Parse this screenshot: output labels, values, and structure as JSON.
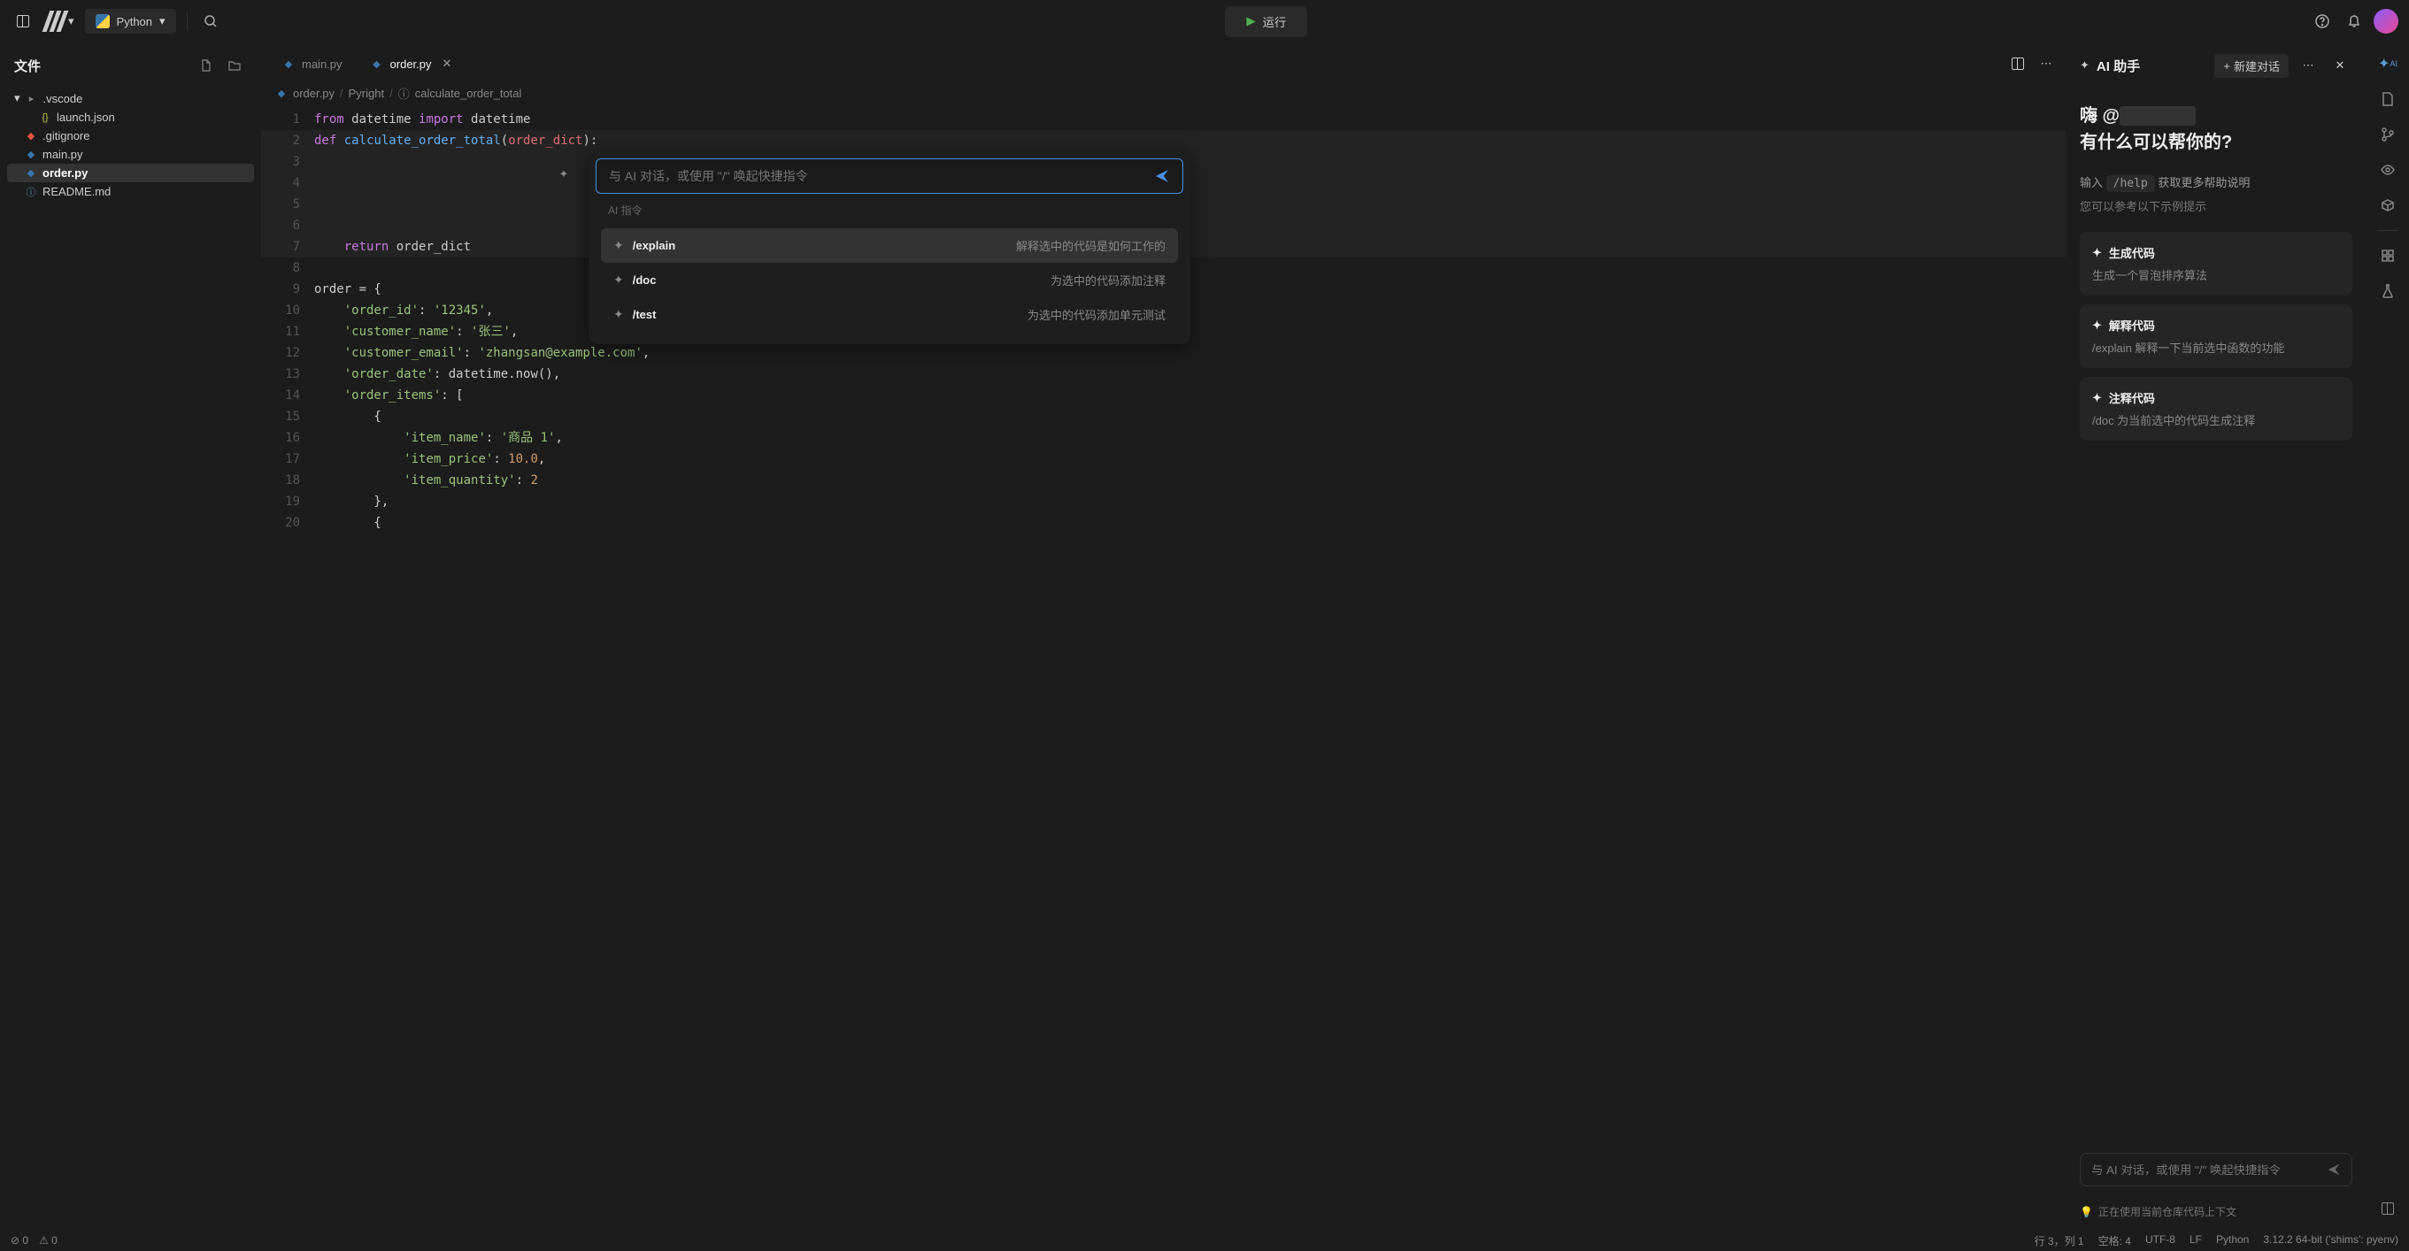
{
  "topbar": {
    "language": "Python",
    "run": "运行"
  },
  "files": {
    "title": "文件",
    "tree": [
      {
        "name": ".vscode",
        "type": "folder",
        "open": true,
        "indent": 0
      },
      {
        "name": "launch.json",
        "type": "json",
        "indent": 2
      },
      {
        "name": ".gitignore",
        "type": "git",
        "indent": 1
      },
      {
        "name": "main.py",
        "type": "py",
        "indent": 1
      },
      {
        "name": "order.py",
        "type": "py",
        "indent": 1,
        "active": true
      },
      {
        "name": "README.md",
        "type": "md",
        "indent": 1
      }
    ]
  },
  "tabs": [
    {
      "name": "main.py",
      "active": false
    },
    {
      "name": "order.py",
      "active": true
    }
  ],
  "breadcrumb": {
    "file": "order.py",
    "module": "Pyright",
    "symbol": "calculate_order_total"
  },
  "code": {
    "lines": [
      {
        "n": 1,
        "html": "<span class='kw'>from</span> datetime <span class='kw'>import</span> datetime"
      },
      {
        "n": 2,
        "html": "<span class='kw'>def</span> <span class='fn'>calculate_order_total</span>(<span class='var'>order_dict</span>):",
        "hl": true
      },
      {
        "n": 3,
        "html": "",
        "hl": true
      },
      {
        "n": 4,
        "html": "",
        "hl": true
      },
      {
        "n": 5,
        "html": "",
        "hl": true
      },
      {
        "n": 6,
        "html": "",
        "hl": true
      },
      {
        "n": 7,
        "html": "    <span class='kw'>return</span> order_dict",
        "hl": true
      },
      {
        "n": 8,
        "html": ""
      },
      {
        "n": 9,
        "html": "order = {"
      },
      {
        "n": 10,
        "html": "    <span class='str'>'order_id'</span>: <span class='str'>'12345'</span>,"
      },
      {
        "n": 11,
        "html": "    <span class='str'>'customer_name'</span>: <span class='str'>'张三'</span>,"
      },
      {
        "n": 12,
        "html": "    <span class='str'>'customer_email'</span>: <span class='str'>'zhangsan@example.com'</span>,"
      },
      {
        "n": 13,
        "html": "    <span class='str'>'order_date'</span>: datetime.now(),"
      },
      {
        "n": 14,
        "html": "    <span class='str'>'order_items'</span>: ["
      },
      {
        "n": 15,
        "html": "        {"
      },
      {
        "n": 16,
        "html": "            <span class='str'>'item_name'</span>: <span class='str'>'商品 1'</span>,"
      },
      {
        "n": 17,
        "html": "            <span class='str'>'item_price'</span>: <span class='num'>10.0</span>,"
      },
      {
        "n": 18,
        "html": "            <span class='str'>'item_quantity'</span>: <span class='num'>2</span>"
      },
      {
        "n": 19,
        "html": "        },"
      },
      {
        "n": 20,
        "html": "        {"
      }
    ]
  },
  "ai_inline": {
    "placeholder": "与 AI 对话，或使用 \"/\" 唤起快捷指令",
    "label": "AI 指令",
    "items": [
      {
        "cmd": "/explain",
        "desc": "解释选中的代码是如何工作的",
        "hl": true
      },
      {
        "cmd": "/doc",
        "desc": "为选中的代码添加注释"
      },
      {
        "cmd": "/test",
        "desc": "为选中的代码添加单元测试"
      }
    ]
  },
  "side": {
    "title": "AI 助手",
    "new_conv": "新建对话",
    "greeting_prefix": "嗨 @",
    "greeting_line2": "有什么可以帮你的?",
    "help_prefix": "输入",
    "help_cmd": "/help",
    "help_suffix": "获取更多帮助说明",
    "sub_hint": "您可以参考以下示例提示",
    "cards": [
      {
        "title": "生成代码",
        "desc": "生成一个冒泡排序算法"
      },
      {
        "title": "解释代码",
        "desc": "/explain 解释一下当前选中函数的功能"
      },
      {
        "title": "注释代码",
        "desc": "/doc 为当前选中的代码生成注释"
      }
    ],
    "input_placeholder": "与 AI 对话，或使用 \"/\" 唤起快捷指令",
    "ctx": "正在使用当前仓库代码上下文"
  },
  "statusbar": {
    "errors": "0",
    "warnings": "0",
    "cursor": "行 3，列 1",
    "spaces": "空格: 4",
    "encoding": "UTF-8",
    "eol": "LF",
    "lang": "Python",
    "interpreter": "3.12.2 64-bit ('shims': pyenv)"
  }
}
